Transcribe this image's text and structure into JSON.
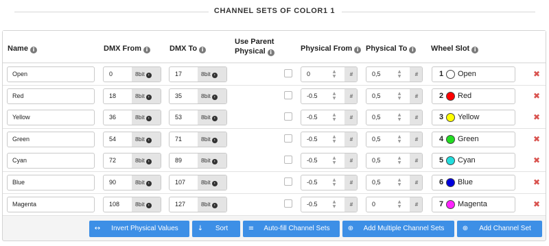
{
  "page": {
    "title": "CHANNEL SETS OF COLOR1 1"
  },
  "columns": {
    "name": "Name",
    "dmx_from": "DMX From",
    "dmx_to": "DMX To",
    "use_parent_1": "Use Parent",
    "use_parent_2": "Physical",
    "physical_from": "Physical From",
    "physical_to": "Physical To",
    "wheel_slot": "Wheel Slot"
  },
  "info_glyph": "i",
  "bit_label": "8bit",
  "hash_label": "#",
  "rows": [
    {
      "name": "Open",
      "dmx_from": "0",
      "dmx_to": "17",
      "physical_from": "0",
      "physical_to": "0,5",
      "slot_num": "1",
      "slot_name": "Open",
      "slot_color": "#ffffff"
    },
    {
      "name": "Red",
      "dmx_from": "18",
      "dmx_to": "35",
      "physical_from": "-0.5",
      "physical_to": "0,5",
      "slot_num": "2",
      "slot_name": "Red",
      "slot_color": "#ff0000"
    },
    {
      "name": "Yellow",
      "dmx_from": "36",
      "dmx_to": "53",
      "physical_from": "-0.5",
      "physical_to": "0,5",
      "slot_num": "3",
      "slot_name": "Yellow",
      "slot_color": "#ffff00"
    },
    {
      "name": "Green",
      "dmx_from": "54",
      "dmx_to": "71",
      "physical_from": "-0.5",
      "physical_to": "0,5",
      "slot_num": "4",
      "slot_name": "Green",
      "slot_color": "#22dd22"
    },
    {
      "name": "Cyan",
      "dmx_from": "72",
      "dmx_to": "89",
      "physical_from": "-0.5",
      "physical_to": "0,5",
      "slot_num": "5",
      "slot_name": "Cyan",
      "slot_color": "#22dddd"
    },
    {
      "name": "Blue",
      "dmx_from": "90",
      "dmx_to": "107",
      "physical_from": "-0.5",
      "physical_to": "0,5",
      "slot_num": "6",
      "slot_name": "Blue",
      "slot_color": "#0000dd"
    },
    {
      "name": "Magenta",
      "dmx_from": "108",
      "dmx_to": "127",
      "physical_from": "-0.5",
      "physical_to": "0",
      "slot_num": "7",
      "slot_name": "Magenta",
      "slot_color": "#ff22ff"
    }
  ],
  "actions": {
    "invert": "Invert Physical Values",
    "sort": "Sort",
    "autofill": "Auto-fill Channel Sets",
    "add_multiple": "Add Multiple Channel Sets",
    "add": "Add Channel Set"
  },
  "colors": {
    "accent": "#3d8fe6",
    "delete": "#d9534f"
  },
  "icons": {
    "invert": "swap-horizontal-icon",
    "sort": "sort-numeric-icon",
    "autofill": "list-icon",
    "add_multiple": "plus-circle-icon",
    "add": "plus-circle-icon",
    "delete": "close-icon"
  }
}
